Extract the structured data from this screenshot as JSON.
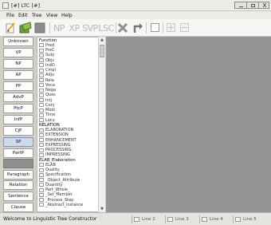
{
  "window": {
    "title": "[#] LTC [#]"
  },
  "menu": [
    "File",
    "Edit",
    "Tree",
    "View",
    "Help"
  ],
  "toolbar": {
    "text_buttons": [
      "NP",
      "XP",
      "SVP",
      "LSC"
    ]
  },
  "left_buttons": [
    {
      "label": "Unknown",
      "selected": false
    },
    {
      "label": "VP",
      "selected": false
    },
    {
      "label": "NP",
      "selected": false
    },
    {
      "label": "AP",
      "selected": false
    },
    {
      "label": "PP",
      "selected": false
    },
    {
      "label": "AdvP",
      "selected": false
    },
    {
      "label": "PtcP",
      "selected": false
    },
    {
      "label": "InfP",
      "selected": false
    },
    {
      "label": "CjP",
      "selected": false
    },
    {
      "label": "SP",
      "selected": true
    },
    {
      "label": "PartP",
      "selected": false
    },
    {
      "label": "Paragraph",
      "selected": false
    },
    {
      "label": "Relation",
      "selected": false
    },
    {
      "label": "Sentence",
      "selected": false
    },
    {
      "label": "Clause",
      "selected": false
    }
  ],
  "list": [
    {
      "type": "header",
      "label": "Function"
    },
    {
      "type": "item",
      "label": "Pred"
    },
    {
      "type": "item",
      "label": "PreC"
    },
    {
      "type": "item",
      "label": "Subj"
    },
    {
      "type": "item",
      "label": "Objc"
    },
    {
      "type": "item",
      "label": "IndO"
    },
    {
      "type": "item",
      "label": "Cmpl"
    },
    {
      "type": "item",
      "label": "Adju"
    },
    {
      "type": "item",
      "label": "Rela"
    },
    {
      "type": "item",
      "label": "Voca"
    },
    {
      "type": "item",
      "label": "Nega"
    },
    {
      "type": "item",
      "label": "Ques"
    },
    {
      "type": "item",
      "label": "Intj"
    },
    {
      "type": "item",
      "label": "Conj"
    },
    {
      "type": "item",
      "label": "Modi"
    },
    {
      "type": "item",
      "label": "Time"
    },
    {
      "type": "item",
      "label": "Locu"
    },
    {
      "type": "header",
      "label": "RELATION"
    },
    {
      "type": "item",
      "label": "ELABORATION"
    },
    {
      "type": "item",
      "label": "EXTENSION"
    },
    {
      "type": "item",
      "label": "ENHANCEMENT"
    },
    {
      "type": "item",
      "label": "EXPRESSING"
    },
    {
      "type": "item",
      "label": "PROCESSING"
    },
    {
      "type": "item",
      "label": "IMPRESSING"
    },
    {
      "type": "header",
      "label": "ELAB_Elaboration"
    },
    {
      "type": "item",
      "label": "ELAB"
    },
    {
      "type": "item",
      "label": "Quality"
    },
    {
      "type": "item",
      "label": "Specification"
    },
    {
      "type": "item",
      "label": "_Object_Attribute"
    },
    {
      "type": "item",
      "label": "Quantity"
    },
    {
      "type": "item",
      "label": "Part_Whole_"
    },
    {
      "type": "item",
      "label": "_Set_Member"
    },
    {
      "type": "item",
      "label": "_Process_Step"
    },
    {
      "type": "item",
      "label": "_Abstract_Instance"
    }
  ],
  "status": {
    "message": "Welcome to Linguistic Tree Constructor",
    "lines": [
      "Line 2",
      "Line 3",
      "Line 4",
      "Line 5"
    ]
  },
  "colors": {
    "canvas": "#959595",
    "selected_button": "#cfd9ea"
  }
}
